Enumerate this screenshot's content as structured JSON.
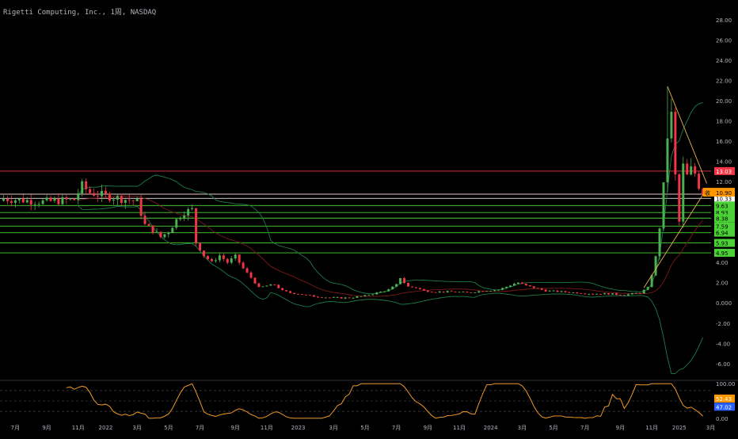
{
  "chart_data": {
    "type": "candlestick",
    "title": "Rigetti Computing, Inc., 1周, NASDAQ",
    "colors": {
      "background": "#000000",
      "up": "#4caf50",
      "down": "#f23645",
      "bands": "#1e7a4a",
      "ma": "#7a1a1a",
      "axis_text": "#b2b5be",
      "resistance": "#f23645",
      "support": "#4cd137",
      "level_white": "#e0e0e0",
      "trend": "#e8b04a",
      "rsi_fast": "#2962ff",
      "rsi_slow": "#ff9800"
    },
    "main_axis": {
      "ylim": [
        -7.5,
        29
      ],
      "tick_labels": [
        "28.00",
        "26.00",
        "24.00",
        "22.00",
        "20.00",
        "18.00",
        "16.00",
        "14.00",
        "12.00",
        "10.00",
        "8.00",
        "6.00",
        "4.00",
        "2.00",
        "0.000",
        "-2.00",
        "-4.00",
        "-6.00"
      ],
      "tick_values": [
        28,
        26,
        24,
        22,
        20,
        18,
        16,
        14,
        12,
        10,
        8,
        6,
        4,
        2,
        0,
        -2,
        -4,
        -6
      ]
    },
    "x_axis": {
      "tick_labels": [
        "7月",
        "9月",
        "11月",
        "2022",
        "3月",
        "5月",
        "7月",
        "9月",
        "11月",
        "2023",
        "3月",
        "5月",
        "7月",
        "9月",
        "11月",
        "2024",
        "3月",
        "5月",
        "7月",
        "9月",
        "11月",
        "2025",
        "3月"
      ],
      "tick_positions": [
        3,
        11,
        19,
        26,
        34,
        42,
        50,
        59,
        67,
        75,
        84,
        92,
        100,
        108,
        116,
        124,
        132,
        140,
        148,
        157,
        165,
        172,
        180
      ]
    },
    "price_levels": [
      {
        "label": "13.03",
        "value": 13.03,
        "kind": "resistance"
      },
      {
        "label": "10.75",
        "value": 10.75,
        "kind": "resistance-white"
      },
      {
        "label": "10.33",
        "value": 10.33,
        "kind": "white"
      },
      {
        "label": "9.63",
        "value": 9.63,
        "kind": "support"
      },
      {
        "label": "8.93",
        "value": 8.93,
        "kind": "support"
      },
      {
        "label": "8.38",
        "value": 8.38,
        "kind": "support"
      },
      {
        "label": "7.59",
        "value": 7.59,
        "kind": "support"
      },
      {
        "label": "6.94",
        "value": 6.94,
        "kind": "support"
      },
      {
        "label": "5.93",
        "value": 5.93,
        "kind": "support"
      },
      {
        "label": "4.95",
        "value": 4.95,
        "kind": "support"
      }
    ],
    "last_price": {
      "label": "10.90",
      "value": 10.9,
      "prefix": "收"
    },
    "anchors": [
      [
        0,
        10.3
      ],
      [
        10,
        10.0
      ],
      [
        18,
        10.2
      ],
      [
        20,
        11.6
      ],
      [
        22,
        10.9
      ],
      [
        26,
        10.6
      ],
      [
        30,
        10.3
      ],
      [
        34,
        10.0
      ],
      [
        36,
        7.7
      ],
      [
        38,
        7.2
      ],
      [
        40,
        6.5
      ],
      [
        42,
        7.1
      ],
      [
        44,
        8.2
      ],
      [
        46,
        9.0
      ],
      [
        48,
        9.2
      ],
      [
        49,
        6.0
      ],
      [
        51,
        4.7
      ],
      [
        53,
        4.0
      ],
      [
        55,
        4.7
      ],
      [
        57,
        4.0
      ],
      [
        59,
        4.6
      ],
      [
        61,
        3.4
      ],
      [
        63,
        2.5
      ],
      [
        65,
        1.5
      ],
      [
        67,
        1.7
      ],
      [
        69,
        1.8
      ],
      [
        71,
        1.2
      ],
      [
        73,
        1.0
      ],
      [
        75,
        0.9
      ],
      [
        78,
        0.7
      ],
      [
        80,
        0.6
      ],
      [
        84,
        0.5
      ],
      [
        88,
        0.5
      ],
      [
        92,
        0.7
      ],
      [
        95,
        1.0
      ],
      [
        98,
        1.3
      ],
      [
        100,
        1.8
      ],
      [
        101,
        2.5
      ],
      [
        102,
        2.0
      ],
      [
        103,
        1.6
      ],
      [
        105,
        1.5
      ],
      [
        107,
        1.2
      ],
      [
        110,
        1.1
      ],
      [
        115,
        1.1
      ],
      [
        118,
        1.0
      ],
      [
        122,
        1.2
      ],
      [
        126,
        1.3
      ],
      [
        128,
        1.6
      ],
      [
        130,
        1.9
      ],
      [
        131,
        2.0
      ],
      [
        133,
        1.7
      ],
      [
        135,
        1.5
      ],
      [
        138,
        1.2
      ],
      [
        142,
        1.1
      ],
      [
        146,
        1.0
      ],
      [
        150,
        0.9
      ],
      [
        154,
        0.9
      ],
      [
        158,
        0.8
      ],
      [
        160,
        0.9
      ],
      [
        162,
        1.0
      ],
      [
        164,
        1.5
      ],
      [
        165,
        2.8
      ],
      [
        166,
        4.5
      ],
      [
        167,
        7.5
      ],
      [
        168,
        11.5
      ],
      [
        169,
        16.5
      ],
      [
        170,
        18.5
      ],
      [
        171,
        12.5
      ],
      [
        172,
        8.0
      ],
      [
        173,
        13.5
      ],
      [
        174,
        12.5
      ],
      [
        175,
        13.2
      ],
      [
        176,
        12.8
      ],
      [
        177,
        11.6
      ],
      [
        178,
        10.9
      ]
    ],
    "candles_count": 179,
    "rsi": {
      "ylim": [
        -5,
        105
      ],
      "tick_labels": [
        "100.00",
        "52.43",
        "47.02",
        "0.00"
      ],
      "tick_values": [
        100,
        52.43,
        47.02,
        0
      ],
      "fast_label": "47.02",
      "slow_label": "52.43",
      "dashed_levels": [
        80,
        50,
        20
      ]
    }
  }
}
